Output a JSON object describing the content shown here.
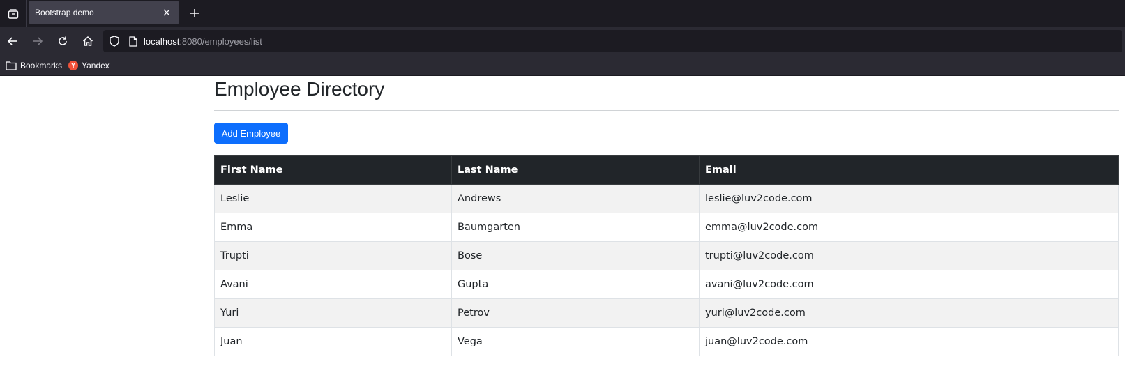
{
  "browser": {
    "tab": {
      "title": "Bootstrap demo"
    },
    "url": {
      "host": "localhost",
      "rest": ":8080/employees/list"
    },
    "bookmarks": [
      {
        "label": "Bookmarks",
        "icon": "folder-icon"
      },
      {
        "label": "Yandex",
        "icon": "yandex-favicon",
        "favicon_letter": "Y",
        "favicon_color": "#f0523a"
      }
    ]
  },
  "page": {
    "title": "Employee Directory",
    "add_button_label": "Add Employee",
    "accent_color": "#0d6efd",
    "table": {
      "headers": [
        "First Name",
        "Last Name",
        "Email"
      ],
      "rows": [
        [
          "Leslie",
          "Andrews",
          "leslie@luv2code.com"
        ],
        [
          "Emma",
          "Baumgarten",
          "emma@luv2code.com"
        ],
        [
          "Trupti",
          "Bose",
          "trupti@luv2code.com"
        ],
        [
          "Avani",
          "Gupta",
          "avani@luv2code.com"
        ],
        [
          "Yuri",
          "Petrov",
          "yuri@luv2code.com"
        ],
        [
          "Juan",
          "Vega",
          "juan@luv2code.com"
        ]
      ]
    }
  }
}
